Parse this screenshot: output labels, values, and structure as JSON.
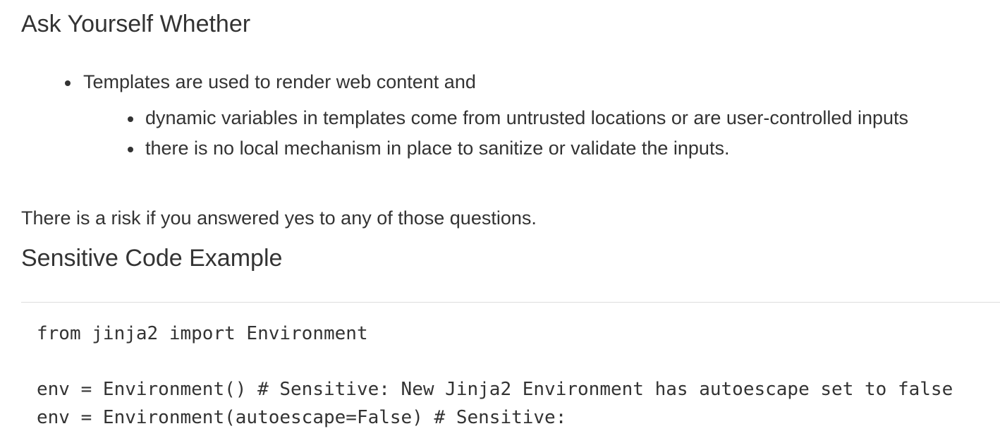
{
  "sections": {
    "ask_yourself": {
      "heading": "Ask Yourself Whether",
      "item": "Templates are used to render web content and",
      "subitems": [
        "dynamic variables in templates come from untrusted locations or are user-controlled inputs",
        "there is no local mechanism in place to sanitize or validate the inputs."
      ],
      "risk_note": "There is a risk if you answered yes to any of those questions."
    },
    "sensitive_example": {
      "heading": "Sensitive Code Example",
      "code_lines": [
        "from jinja2 import Environment",
        "",
        "env = Environment() # Sensitive: New Jinja2 Environment has autoescape set to false",
        "env = Environment(autoescape=False) # Sensitive:"
      ]
    }
  }
}
